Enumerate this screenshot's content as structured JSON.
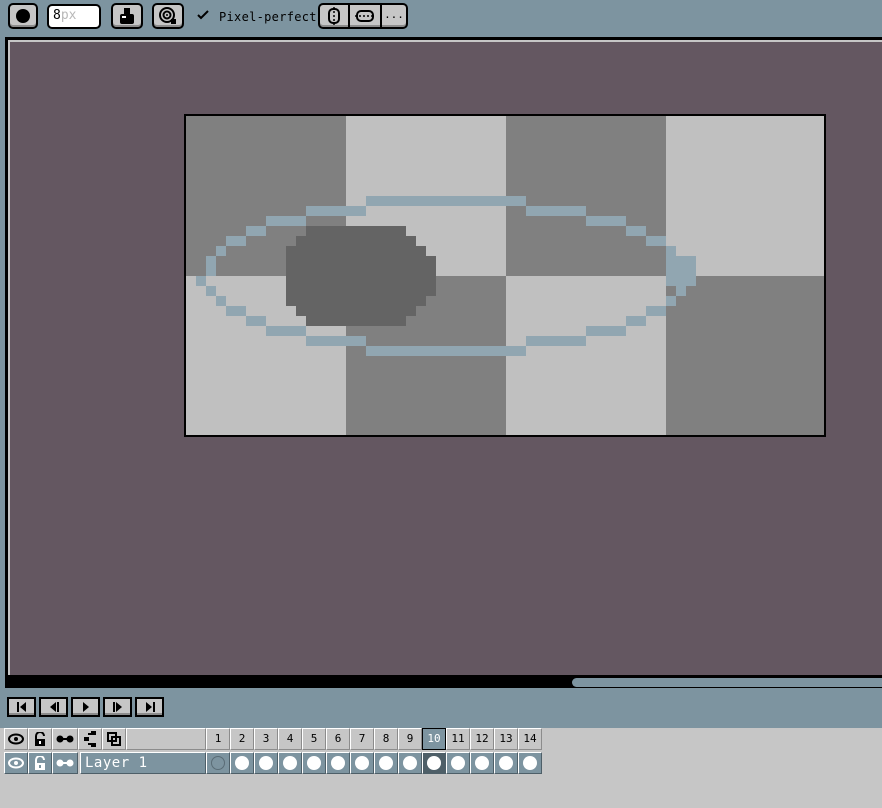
{
  "toolbar": {
    "brush_size_value": "8",
    "brush_size_unit": "px",
    "pixel_perfect_label": "Pixel-perfect",
    "more_label": "..."
  },
  "timeline": {
    "layer_name": "Layer 1",
    "frames": [
      "1",
      "2",
      "3",
      "4",
      "5",
      "6",
      "7",
      "8",
      "9",
      "10",
      "11",
      "12",
      "13",
      "14"
    ],
    "active_frame": "10"
  },
  "colors": {
    "background": "#645761",
    "panel": "#7d94a0",
    "checker_dark": "#808080",
    "checker_light": "#c0c0c0",
    "ellipse_outline": "#91a6b1",
    "ellipse_fill": "#646464"
  }
}
